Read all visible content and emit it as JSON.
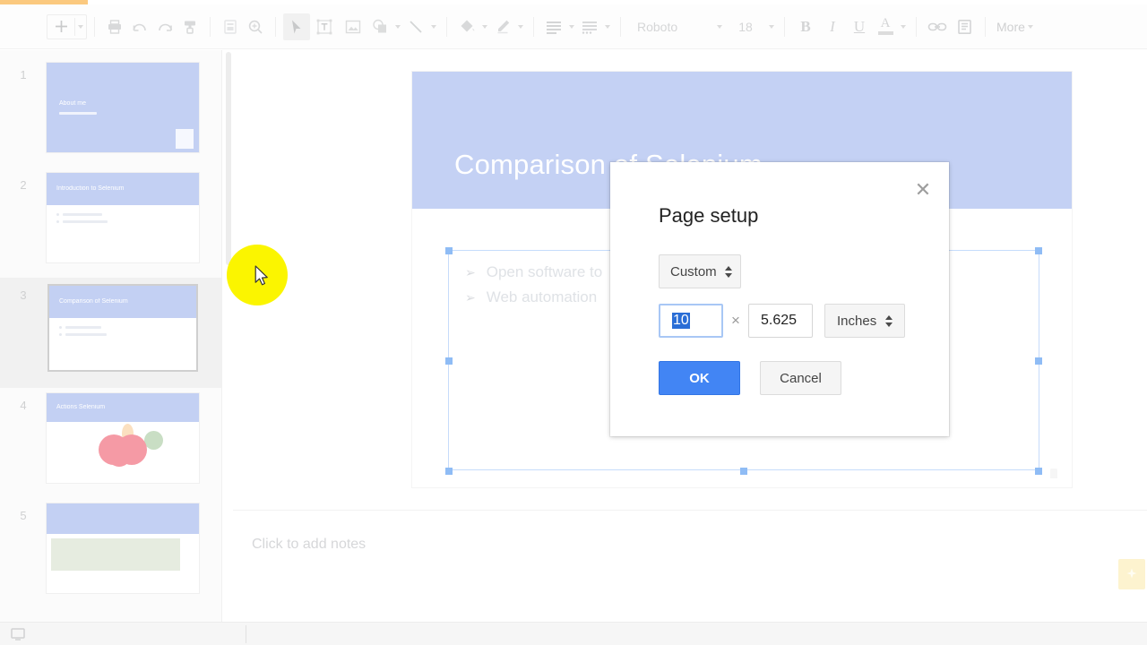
{
  "app": {
    "name": "Google Slides"
  },
  "toolbar": {
    "groups": [
      {
        "name": "new-slide",
        "icon": "plus-icon",
        "has_caret": true
      },
      {
        "name": "print",
        "icon": "printer-icon"
      },
      {
        "name": "undo",
        "icon": "undo-icon"
      },
      {
        "name": "redo",
        "icon": "redo-icon"
      },
      {
        "name": "paint-format",
        "icon": "paint-roller-icon"
      },
      {
        "name": "layout",
        "icon": "layout-icon"
      },
      {
        "name": "zoom",
        "icon": "magnifier-icon"
      },
      {
        "name": "select",
        "icon": "cursor-arrow-icon"
      },
      {
        "name": "text-box",
        "icon": "text-box-icon"
      },
      {
        "name": "image",
        "icon": "image-icon"
      },
      {
        "name": "shape",
        "icon": "shape-icon",
        "has_caret": true
      },
      {
        "name": "line",
        "icon": "line-icon",
        "has_caret": true
      },
      {
        "name": "fill-color",
        "icon": "paint-bucket-icon",
        "has_caret": true
      },
      {
        "name": "line-color",
        "icon": "pencil-icon",
        "has_caret": true
      },
      {
        "name": "align",
        "icon": "align-lines-icon",
        "has_caret": true
      },
      {
        "name": "list",
        "icon": "bullet-list-icon",
        "has_caret": true
      }
    ],
    "font_family": "Roboto",
    "font_size": "18",
    "bold_label": "B",
    "italic_label": "I",
    "underline_label": "U",
    "text_color_label": "A",
    "link_icon": "link-icon",
    "comment_icon": "comment-icon",
    "more_label": "More"
  },
  "filmstrip": {
    "slides": [
      {
        "number": "1",
        "title": "About me",
        "selected": false,
        "layout": "title-full",
        "band_height": 100
      },
      {
        "number": "2",
        "title": "Introduction to Selenium",
        "selected": false,
        "layout": "title-body",
        "band_height": 36
      },
      {
        "number": "3",
        "title": "Comparison of Selenium",
        "selected": true,
        "layout": "title-body",
        "band_height": 36
      },
      {
        "number": "4",
        "title": "Actions Selenium",
        "selected": false,
        "layout": "title-shapes",
        "band_height": 32
      },
      {
        "number": "5",
        "title": "",
        "selected": false,
        "layout": "title-green",
        "band_height": 34
      }
    ]
  },
  "slide": {
    "title": "Comparison of Selenium",
    "bullets": [
      {
        "mark": "➢",
        "text": "Open software to"
      },
      {
        "mark": "➢",
        "text": "Web automation"
      }
    ]
  },
  "notes": {
    "placeholder": "Click to add notes"
  },
  "explore": {
    "icon": "explore-star-icon"
  },
  "status_bar": {
    "icon": "presentation-icon"
  },
  "cursor": {
    "icon": "mouse-pointer-icon",
    "highlight_color": "#fbf500"
  },
  "dialog": {
    "title": "Page setup",
    "close_icon": "close-icon",
    "preset": "Custom",
    "width_value": "10",
    "width_selected": true,
    "separator": "×",
    "height_value": "5.625",
    "unit": "Inches",
    "ok_label": "OK",
    "cancel_label": "Cancel"
  },
  "colors": {
    "accent_blue": "#4285f4",
    "slide_band": "#c4d1f4",
    "selection_blue": "#2a6ed6",
    "cursor_yellow": "#fbf500",
    "explore_yellow": "#fdf3cf"
  }
}
